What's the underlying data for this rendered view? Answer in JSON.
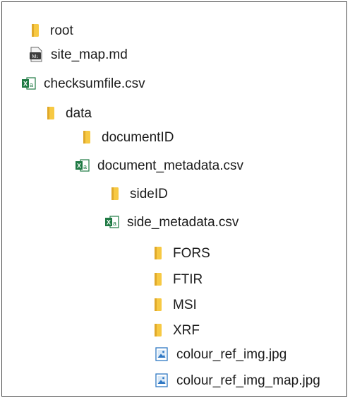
{
  "tree": {
    "root": {
      "label": "root",
      "icon": "folder-icon"
    },
    "site_map": {
      "label": "site_map.md",
      "icon": "markdown-file-icon"
    },
    "checksum": {
      "label": "checksumfile.csv",
      "icon": "csv-file-icon"
    },
    "data": {
      "label": "data",
      "icon": "folder-icon"
    },
    "documentID": {
      "label": "documentID",
      "icon": "folder-icon"
    },
    "doc_meta": {
      "label": "document_metadata.csv",
      "icon": "csv-file-icon"
    },
    "sideID": {
      "label": "sideID",
      "icon": "folder-icon"
    },
    "side_meta": {
      "label": "side_metadata.csv",
      "icon": "csv-file-icon"
    },
    "fors": {
      "label": "FORS",
      "icon": "folder-icon"
    },
    "ftir": {
      "label": "FTIR",
      "icon": "folder-icon"
    },
    "msi": {
      "label": "MSI",
      "icon": "folder-icon"
    },
    "xrf": {
      "label": "XRF",
      "icon": "folder-icon"
    },
    "img": {
      "label": "colour_ref_img.jpg",
      "icon": "image-file-icon"
    },
    "img_map": {
      "label": "colour_ref_img_map.jpg",
      "icon": "image-file-icon"
    }
  },
  "colors": {
    "folder": "#f7c943",
    "folder_dark": "#e0a92a",
    "csv_green": "#1f7a44",
    "image_blue": "#2f78c4",
    "border": "#4a4a4a"
  }
}
